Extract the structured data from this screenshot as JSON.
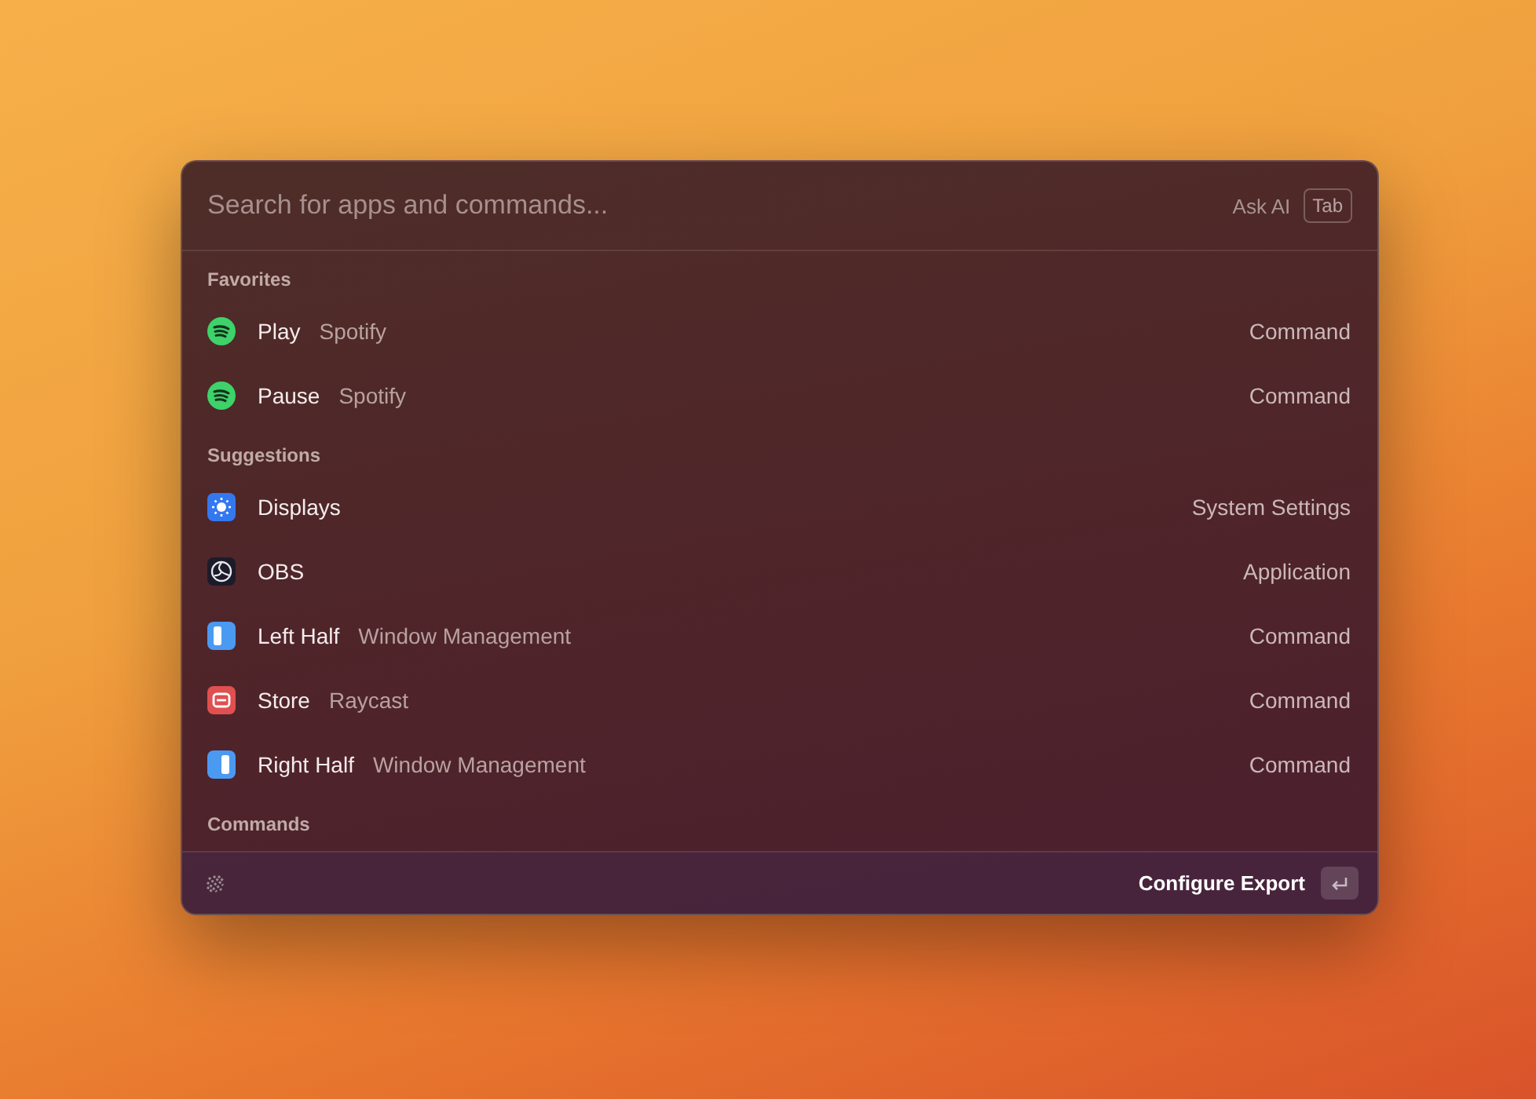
{
  "search": {
    "placeholder": "Search for apps and commands...",
    "ask_ai": "Ask AI",
    "key": "Tab"
  },
  "sections": [
    {
      "title": "Favorites",
      "items": [
        {
          "kind": "audio",
          "title": "Play",
          "subtitle": "Spotify",
          "accessory": "Command"
        },
        {
          "kind": "audio",
          "title": "Pause",
          "subtitle": "Spotify",
          "accessory": "Command"
        }
      ]
    },
    {
      "title": "Suggestions",
      "items": [
        {
          "kind": "sun",
          "title": "Displays",
          "accessory": "System Settings"
        },
        {
          "kind": "aperture",
          "title": "OBS",
          "accessory": "Application"
        },
        {
          "kind": "left-panel",
          "title": "Left Half",
          "subtitle": "Window Management",
          "accessory": "Command"
        },
        {
          "kind": "store",
          "title": "Store",
          "subtitle": "Raycast",
          "accessory": "Command"
        },
        {
          "kind": "right-panel",
          "title": "Right Half",
          "subtitle": "Window Management",
          "accessory": "Command"
        }
      ]
    },
    {
      "title": "Commands"
    }
  ],
  "footer": {
    "action": "Configure Export"
  }
}
